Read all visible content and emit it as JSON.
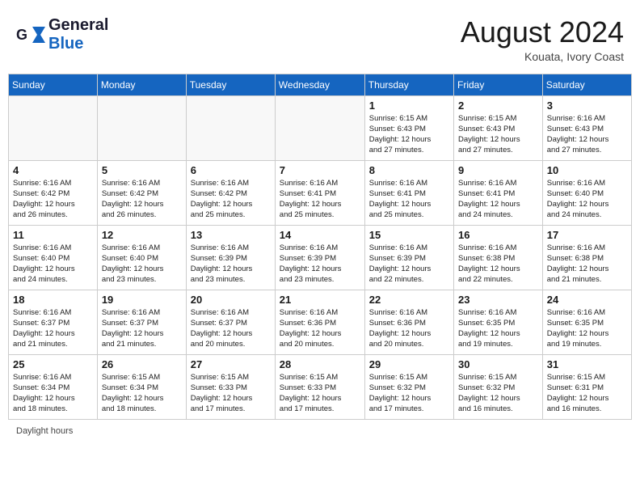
{
  "header": {
    "logo_general": "General",
    "logo_blue": "Blue",
    "month_year": "August 2024",
    "location": "Kouata, Ivory Coast"
  },
  "days_of_week": [
    "Sunday",
    "Monday",
    "Tuesday",
    "Wednesday",
    "Thursday",
    "Friday",
    "Saturday"
  ],
  "weeks": [
    [
      {
        "day": "",
        "info": ""
      },
      {
        "day": "",
        "info": ""
      },
      {
        "day": "",
        "info": ""
      },
      {
        "day": "",
        "info": ""
      },
      {
        "day": "1",
        "info": "Sunrise: 6:15 AM\nSunset: 6:43 PM\nDaylight: 12 hours\nand 27 minutes."
      },
      {
        "day": "2",
        "info": "Sunrise: 6:15 AM\nSunset: 6:43 PM\nDaylight: 12 hours\nand 27 minutes."
      },
      {
        "day": "3",
        "info": "Sunrise: 6:16 AM\nSunset: 6:43 PM\nDaylight: 12 hours\nand 27 minutes."
      }
    ],
    [
      {
        "day": "4",
        "info": "Sunrise: 6:16 AM\nSunset: 6:42 PM\nDaylight: 12 hours\nand 26 minutes."
      },
      {
        "day": "5",
        "info": "Sunrise: 6:16 AM\nSunset: 6:42 PM\nDaylight: 12 hours\nand 26 minutes."
      },
      {
        "day": "6",
        "info": "Sunrise: 6:16 AM\nSunset: 6:42 PM\nDaylight: 12 hours\nand 25 minutes."
      },
      {
        "day": "7",
        "info": "Sunrise: 6:16 AM\nSunset: 6:41 PM\nDaylight: 12 hours\nand 25 minutes."
      },
      {
        "day": "8",
        "info": "Sunrise: 6:16 AM\nSunset: 6:41 PM\nDaylight: 12 hours\nand 25 minutes."
      },
      {
        "day": "9",
        "info": "Sunrise: 6:16 AM\nSunset: 6:41 PM\nDaylight: 12 hours\nand 24 minutes."
      },
      {
        "day": "10",
        "info": "Sunrise: 6:16 AM\nSunset: 6:40 PM\nDaylight: 12 hours\nand 24 minutes."
      }
    ],
    [
      {
        "day": "11",
        "info": "Sunrise: 6:16 AM\nSunset: 6:40 PM\nDaylight: 12 hours\nand 24 minutes."
      },
      {
        "day": "12",
        "info": "Sunrise: 6:16 AM\nSunset: 6:40 PM\nDaylight: 12 hours\nand 23 minutes."
      },
      {
        "day": "13",
        "info": "Sunrise: 6:16 AM\nSunset: 6:39 PM\nDaylight: 12 hours\nand 23 minutes."
      },
      {
        "day": "14",
        "info": "Sunrise: 6:16 AM\nSunset: 6:39 PM\nDaylight: 12 hours\nand 23 minutes."
      },
      {
        "day": "15",
        "info": "Sunrise: 6:16 AM\nSunset: 6:39 PM\nDaylight: 12 hours\nand 22 minutes."
      },
      {
        "day": "16",
        "info": "Sunrise: 6:16 AM\nSunset: 6:38 PM\nDaylight: 12 hours\nand 22 minutes."
      },
      {
        "day": "17",
        "info": "Sunrise: 6:16 AM\nSunset: 6:38 PM\nDaylight: 12 hours\nand 21 minutes."
      }
    ],
    [
      {
        "day": "18",
        "info": "Sunrise: 6:16 AM\nSunset: 6:37 PM\nDaylight: 12 hours\nand 21 minutes."
      },
      {
        "day": "19",
        "info": "Sunrise: 6:16 AM\nSunset: 6:37 PM\nDaylight: 12 hours\nand 21 minutes."
      },
      {
        "day": "20",
        "info": "Sunrise: 6:16 AM\nSunset: 6:37 PM\nDaylight: 12 hours\nand 20 minutes."
      },
      {
        "day": "21",
        "info": "Sunrise: 6:16 AM\nSunset: 6:36 PM\nDaylight: 12 hours\nand 20 minutes."
      },
      {
        "day": "22",
        "info": "Sunrise: 6:16 AM\nSunset: 6:36 PM\nDaylight: 12 hours\nand 20 minutes."
      },
      {
        "day": "23",
        "info": "Sunrise: 6:16 AM\nSunset: 6:35 PM\nDaylight: 12 hours\nand 19 minutes."
      },
      {
        "day": "24",
        "info": "Sunrise: 6:16 AM\nSunset: 6:35 PM\nDaylight: 12 hours\nand 19 minutes."
      }
    ],
    [
      {
        "day": "25",
        "info": "Sunrise: 6:16 AM\nSunset: 6:34 PM\nDaylight: 12 hours\nand 18 minutes."
      },
      {
        "day": "26",
        "info": "Sunrise: 6:15 AM\nSunset: 6:34 PM\nDaylight: 12 hours\nand 18 minutes."
      },
      {
        "day": "27",
        "info": "Sunrise: 6:15 AM\nSunset: 6:33 PM\nDaylight: 12 hours\nand 17 minutes."
      },
      {
        "day": "28",
        "info": "Sunrise: 6:15 AM\nSunset: 6:33 PM\nDaylight: 12 hours\nand 17 minutes."
      },
      {
        "day": "29",
        "info": "Sunrise: 6:15 AM\nSunset: 6:32 PM\nDaylight: 12 hours\nand 17 minutes."
      },
      {
        "day": "30",
        "info": "Sunrise: 6:15 AM\nSunset: 6:32 PM\nDaylight: 12 hours\nand 16 minutes."
      },
      {
        "day": "31",
        "info": "Sunrise: 6:15 AM\nSunset: 6:31 PM\nDaylight: 12 hours\nand 16 minutes."
      }
    ]
  ],
  "footer": {
    "daylight_hours": "Daylight hours"
  }
}
